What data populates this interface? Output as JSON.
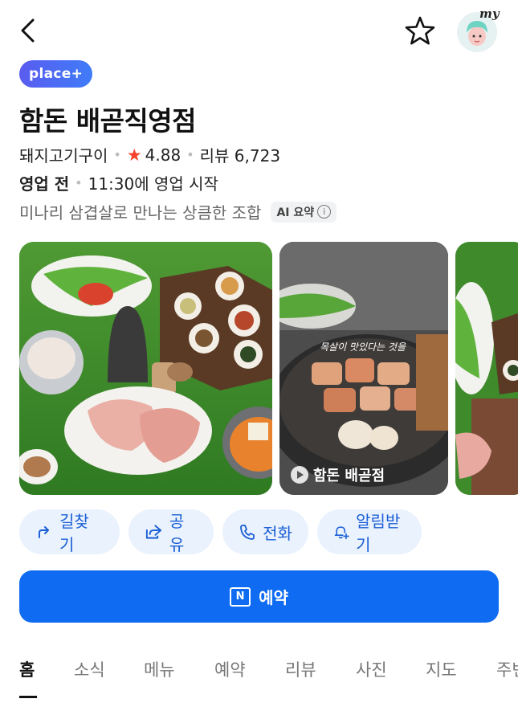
{
  "header": {
    "back_icon": "back-arrow-icon",
    "favorite_icon": "star-outline-icon",
    "my_label": "my"
  },
  "badge": "place+",
  "place": {
    "name": "함돈 배곧직영점",
    "category": "돼지고기구이",
    "rating": "4.88",
    "review_label": "리뷰 6,723",
    "status": "영업 전",
    "hours_text": "11:30에 영업 시작",
    "summary": "미나리 삼겹살로 만나는 상큼한 조합",
    "ai_label": "AI 요약",
    "info_glyph": "i",
    "rating_color": "#f5402b"
  },
  "photos": {
    "video_caption": "함돈 배곧점",
    "video_overlay_text": "목살이 맛있다는 것을"
  },
  "actions": [
    {
      "label": "길찾기",
      "icon": "directions-icon"
    },
    {
      "label": "공유",
      "icon": "share-icon"
    },
    {
      "label": "전화",
      "icon": "phone-icon"
    },
    {
      "label": "알림받기",
      "icon": "bell-plus-icon"
    }
  ],
  "reserve": {
    "label": "예약",
    "icon_letter": "N"
  },
  "tabs": [
    "홈",
    "소식",
    "메뉴",
    "예약",
    "리뷰",
    "사진",
    "지도",
    "주변"
  ],
  "colors": {
    "accent": "#0f6cf2",
    "action_bg": "#eaf2fe",
    "action_text": "#1a5fd6"
  }
}
